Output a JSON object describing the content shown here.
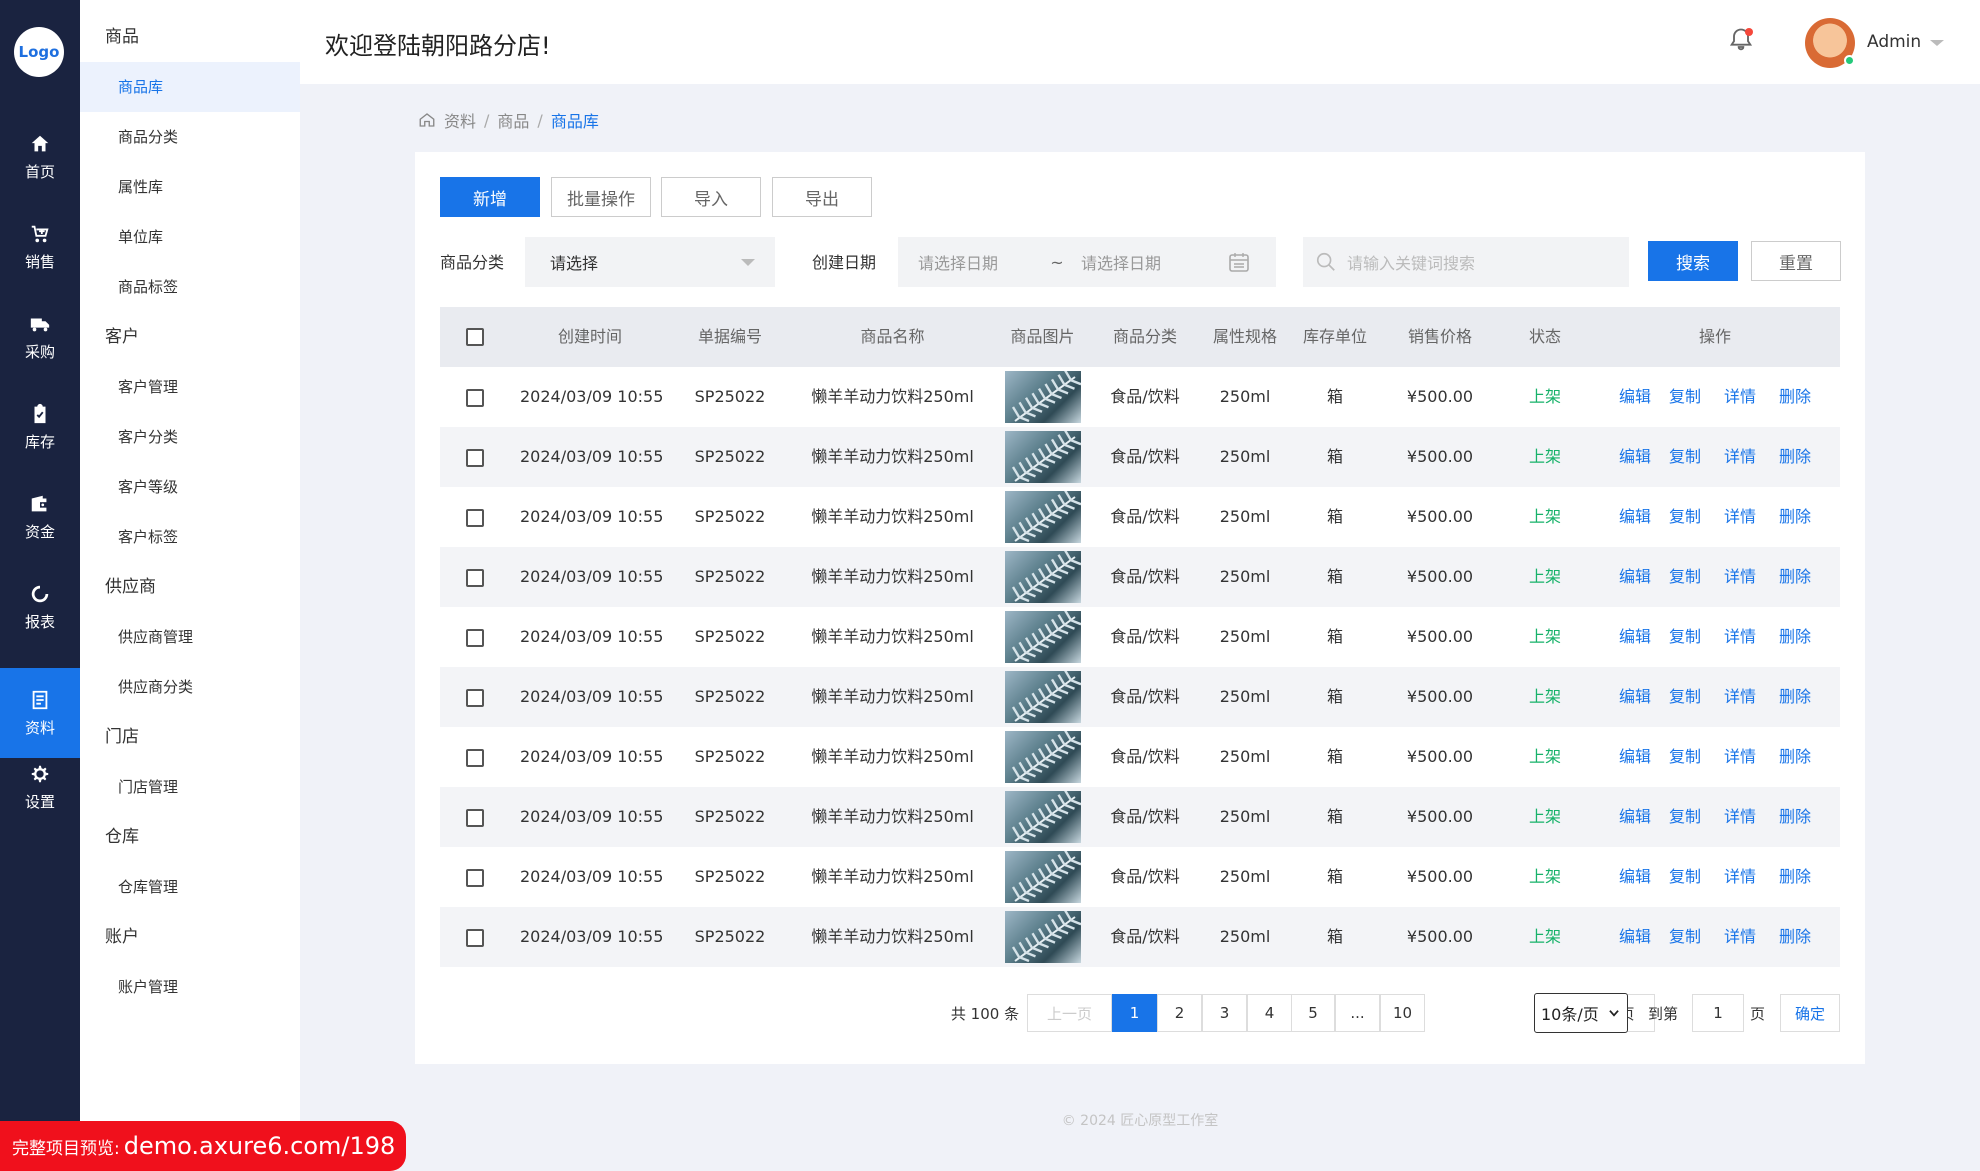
{
  "logo": "Logo",
  "rail": [
    {
      "label": "首页",
      "icon": "home-icon"
    },
    {
      "label": "销售",
      "icon": "cart-icon"
    },
    {
      "label": "采购",
      "icon": "truck-icon"
    },
    {
      "label": "库存",
      "icon": "clipboard-check-icon"
    },
    {
      "label": "资金",
      "icon": "wallet-icon"
    },
    {
      "label": "报表",
      "icon": "report-icon"
    },
    {
      "label": "资料",
      "icon": "document-icon",
      "active": true
    },
    {
      "label": "设置",
      "icon": "gear-icon"
    }
  ],
  "submenu": {
    "groups": [
      {
        "title": "商品",
        "items": [
          "商品库",
          "商品分类",
          "属性库",
          "单位库",
          "商品标签"
        ]
      },
      {
        "title": "客户",
        "items": [
          "客户管理",
          "客户分类",
          "客户等级",
          "客户标签"
        ]
      },
      {
        "title": "供应商",
        "items": [
          "供应商管理",
          "供应商分类"
        ]
      },
      {
        "title": "门店",
        "items": [
          "门店管理"
        ]
      },
      {
        "title": "仓库",
        "items": [
          "仓库管理"
        ]
      },
      {
        "title": "账户",
        "items": [
          "账户管理"
        ]
      }
    ],
    "active": "商品库"
  },
  "header": {
    "welcome": "欢迎登陆朝阳路分店!",
    "user": "Admin"
  },
  "breadcrumb": [
    "资料",
    "商品",
    "商品库"
  ],
  "toolbar": {
    "add": "新增",
    "batch": "批量操作",
    "import": "导入",
    "export": "导出"
  },
  "filters": {
    "category_label": "商品分类",
    "category_value": "请选择",
    "date_label": "创建日期",
    "date_start": "请选择日期",
    "date_sep": "~",
    "date_end": "请选择日期",
    "keyword_placeholder": "请输入关键词搜索",
    "search": "搜索",
    "reset": "重置"
  },
  "table": {
    "columns": [
      "创建时间",
      "单据编号",
      "商品名称",
      "商品图片",
      "商品分类",
      "属性规格",
      "库存单位",
      "销售价格",
      "状态",
      "操作"
    ],
    "rows": [
      {
        "time": "2024/03/09 10:55",
        "code": "SP25022",
        "name": "懒羊羊动力饮料250ml",
        "category": "食品/饮料",
        "spec": "250ml",
        "unit": "箱",
        "price": "¥500.00",
        "status": "上架"
      },
      {
        "time": "2024/03/09 10:55",
        "code": "SP25022",
        "name": "懒羊羊动力饮料250ml",
        "category": "食品/饮料",
        "spec": "250ml",
        "unit": "箱",
        "price": "¥500.00",
        "status": "上架"
      },
      {
        "time": "2024/03/09 10:55",
        "code": "SP25022",
        "name": "懒羊羊动力饮料250ml",
        "category": "食品/饮料",
        "spec": "250ml",
        "unit": "箱",
        "price": "¥500.00",
        "status": "上架"
      },
      {
        "time": "2024/03/09 10:55",
        "code": "SP25022",
        "name": "懒羊羊动力饮料250ml",
        "category": "食品/饮料",
        "spec": "250ml",
        "unit": "箱",
        "price": "¥500.00",
        "status": "上架"
      },
      {
        "time": "2024/03/09 10:55",
        "code": "SP25022",
        "name": "懒羊羊动力饮料250ml",
        "category": "食品/饮料",
        "spec": "250ml",
        "unit": "箱",
        "price": "¥500.00",
        "status": "上架"
      },
      {
        "time": "2024/03/09 10:55",
        "code": "SP25022",
        "name": "懒羊羊动力饮料250ml",
        "category": "食品/饮料",
        "spec": "250ml",
        "unit": "箱",
        "price": "¥500.00",
        "status": "上架"
      },
      {
        "time": "2024/03/09 10:55",
        "code": "SP25022",
        "name": "懒羊羊动力饮料250ml",
        "category": "食品/饮料",
        "spec": "250ml",
        "unit": "箱",
        "price": "¥500.00",
        "status": "上架"
      },
      {
        "time": "2024/03/09 10:55",
        "code": "SP25022",
        "name": "懒羊羊动力饮料250ml",
        "category": "食品/饮料",
        "spec": "250ml",
        "unit": "箱",
        "price": "¥500.00",
        "status": "上架"
      },
      {
        "time": "2024/03/09 10:55",
        "code": "SP25022",
        "name": "懒羊羊动力饮料250ml",
        "category": "食品/饮料",
        "spec": "250ml",
        "unit": "箱",
        "price": "¥500.00",
        "status": "上架"
      },
      {
        "time": "2024/03/09 10:55",
        "code": "SP25022",
        "name": "懒羊羊动力饮料250ml",
        "category": "食品/饮料",
        "spec": "250ml",
        "unit": "箱",
        "price": "¥500.00",
        "status": "上架"
      }
    ],
    "actions": [
      "编辑",
      "复制",
      "详情",
      "删除"
    ]
  },
  "pagination": {
    "total": "共 100 条",
    "prev": "上一页",
    "pages": [
      "1",
      "2",
      "3",
      "4",
      "5",
      "...",
      "10"
    ],
    "current": "1",
    "next": "下一页",
    "page_size": "10条/页",
    "goto_label": "到第",
    "goto_value": "1",
    "page_unit": "页",
    "confirm": "确定"
  },
  "footer": "© 2024    匠心原型工作室",
  "promo": {
    "prefix": "完整项目预览:",
    "url": "demo.axure6.com/198"
  },
  "colors": {
    "primary": "#1874e8",
    "rail": "#1a2340",
    "status_green": "#17b26a",
    "promo_red": "#f0101c"
  }
}
